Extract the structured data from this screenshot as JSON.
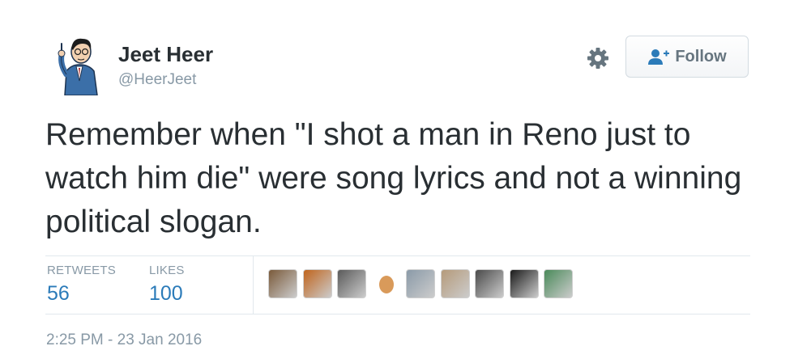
{
  "user": {
    "display_name": "Jeet Heer",
    "handle": "@HeerJeet",
    "avatar_icon": "cartoon-man-avatar-icon"
  },
  "actions": {
    "settings_icon": "gear-icon",
    "follow_label": "Follow",
    "follow_icon": "add-user-icon"
  },
  "tweet": {
    "text": "Remember when \"I shot a man in Reno just to watch him die\" were song lyrics and not a winning political slogan."
  },
  "stats": {
    "retweets_label": "RETWEETS",
    "retweets_count": "56",
    "likes_label": "LIKES",
    "likes_count": "100"
  },
  "likers": [
    {
      "avatar": "dog-photo-avatar",
      "color": "#7a5a3a"
    },
    {
      "avatar": "orange-sphere-avatar",
      "color": "#c0641c"
    },
    {
      "avatar": "portrait-man-avatar",
      "color": "#5a5a5a"
    },
    {
      "avatar": "egg-avatar",
      "color": "#d99a5a"
    },
    {
      "avatar": "team-photo-avatar",
      "color": "#8a9aa8"
    },
    {
      "avatar": "room-photo-avatar",
      "color": "#b59a7a"
    },
    {
      "avatar": "group-photo-avatar",
      "color": "#4a4a4a"
    },
    {
      "avatar": "dark-scene-avatar",
      "color": "#1a1a1a"
    },
    {
      "avatar": "game-scene-avatar",
      "color": "#4a8a5a"
    }
  ],
  "timestamp": "2:25 PM - 23 Jan 2016",
  "colors": {
    "link_blue": "#2b7bb9",
    "muted_gray": "#8899a6",
    "text_dark": "#292f33"
  }
}
